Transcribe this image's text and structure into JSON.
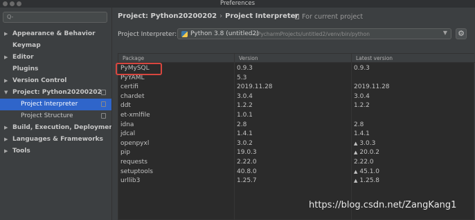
{
  "window": {
    "title": "Preferences"
  },
  "sidebar": {
    "search_placeholder": "Q-",
    "items": [
      {
        "label": "Appearance & Behavior",
        "arrow": "▶",
        "bold": true
      },
      {
        "label": "Keymap",
        "arrow": "",
        "bold": true
      },
      {
        "label": "Editor",
        "arrow": "▶",
        "bold": true
      },
      {
        "label": "Plugins",
        "arrow": "",
        "bold": true
      },
      {
        "label": "Version Control",
        "arrow": "▶",
        "bold": true
      },
      {
        "label": "Project: Python20200202",
        "arrow": "▼",
        "bold": true
      },
      {
        "label": "Project Interpreter",
        "sub": true,
        "selected": true
      },
      {
        "label": "Project Structure",
        "sub": true
      },
      {
        "label": "Build, Execution, Deployment",
        "arrow": "▶",
        "bold": true
      },
      {
        "label": "Languages & Frameworks",
        "arrow": "▶",
        "bold": true
      },
      {
        "label": "Tools",
        "arrow": "▶",
        "bold": true
      }
    ]
  },
  "main": {
    "breadcrumb_project": "Project: Python20200202",
    "breadcrumb_sep": "›",
    "breadcrumb_page": "Project Interpreter",
    "scope_note": "For current project",
    "interpreter_label": "Project Interpreter:",
    "interpreter_name": "Python 3.8 (untitled2)",
    "interpreter_path": "~/PycharmProjects/untitled2/venv/bin/python",
    "settings_glyph": "⚙"
  },
  "table": {
    "headers": [
      "Package",
      "Version",
      "Latest version"
    ],
    "rows": [
      {
        "package": "PyMySQL",
        "version": "0.9.3",
        "latest": "0.9.3",
        "upgrade": false
      },
      {
        "package": "PyYAML",
        "version": "5.3",
        "latest": "",
        "upgrade": false
      },
      {
        "package": "certifi",
        "version": "2019.11.28",
        "latest": "2019.11.28",
        "upgrade": false
      },
      {
        "package": "chardet",
        "version": "3.0.4",
        "latest": "3.0.4",
        "upgrade": false
      },
      {
        "package": "ddt",
        "version": "1.2.2",
        "latest": "1.2.2",
        "upgrade": false
      },
      {
        "package": "et-xmlfile",
        "version": "1.0.1",
        "latest": "",
        "upgrade": false
      },
      {
        "package": "idna",
        "version": "2.8",
        "latest": "2.8",
        "upgrade": false
      },
      {
        "package": "jdcal",
        "version": "1.4.1",
        "latest": "1.4.1",
        "upgrade": false
      },
      {
        "package": "openpyxl",
        "version": "3.0.2",
        "latest": "3.0.3",
        "upgrade": true
      },
      {
        "package": "pip",
        "version": "19.0.3",
        "latest": "20.0.2",
        "upgrade": true
      },
      {
        "package": "requests",
        "version": "2.22.0",
        "latest": "2.22.0",
        "upgrade": false
      },
      {
        "package": "setuptools",
        "version": "40.8.0",
        "latest": "45.1.0",
        "upgrade": true
      },
      {
        "package": "urllib3",
        "version": "1.25.7",
        "latest": "1.25.8",
        "upgrade": true
      }
    ]
  },
  "watermark": "https://blog.csdn.net/ZangKang1",
  "colors": {
    "accent": "#2f65ca",
    "highlight": "#d9463f"
  }
}
